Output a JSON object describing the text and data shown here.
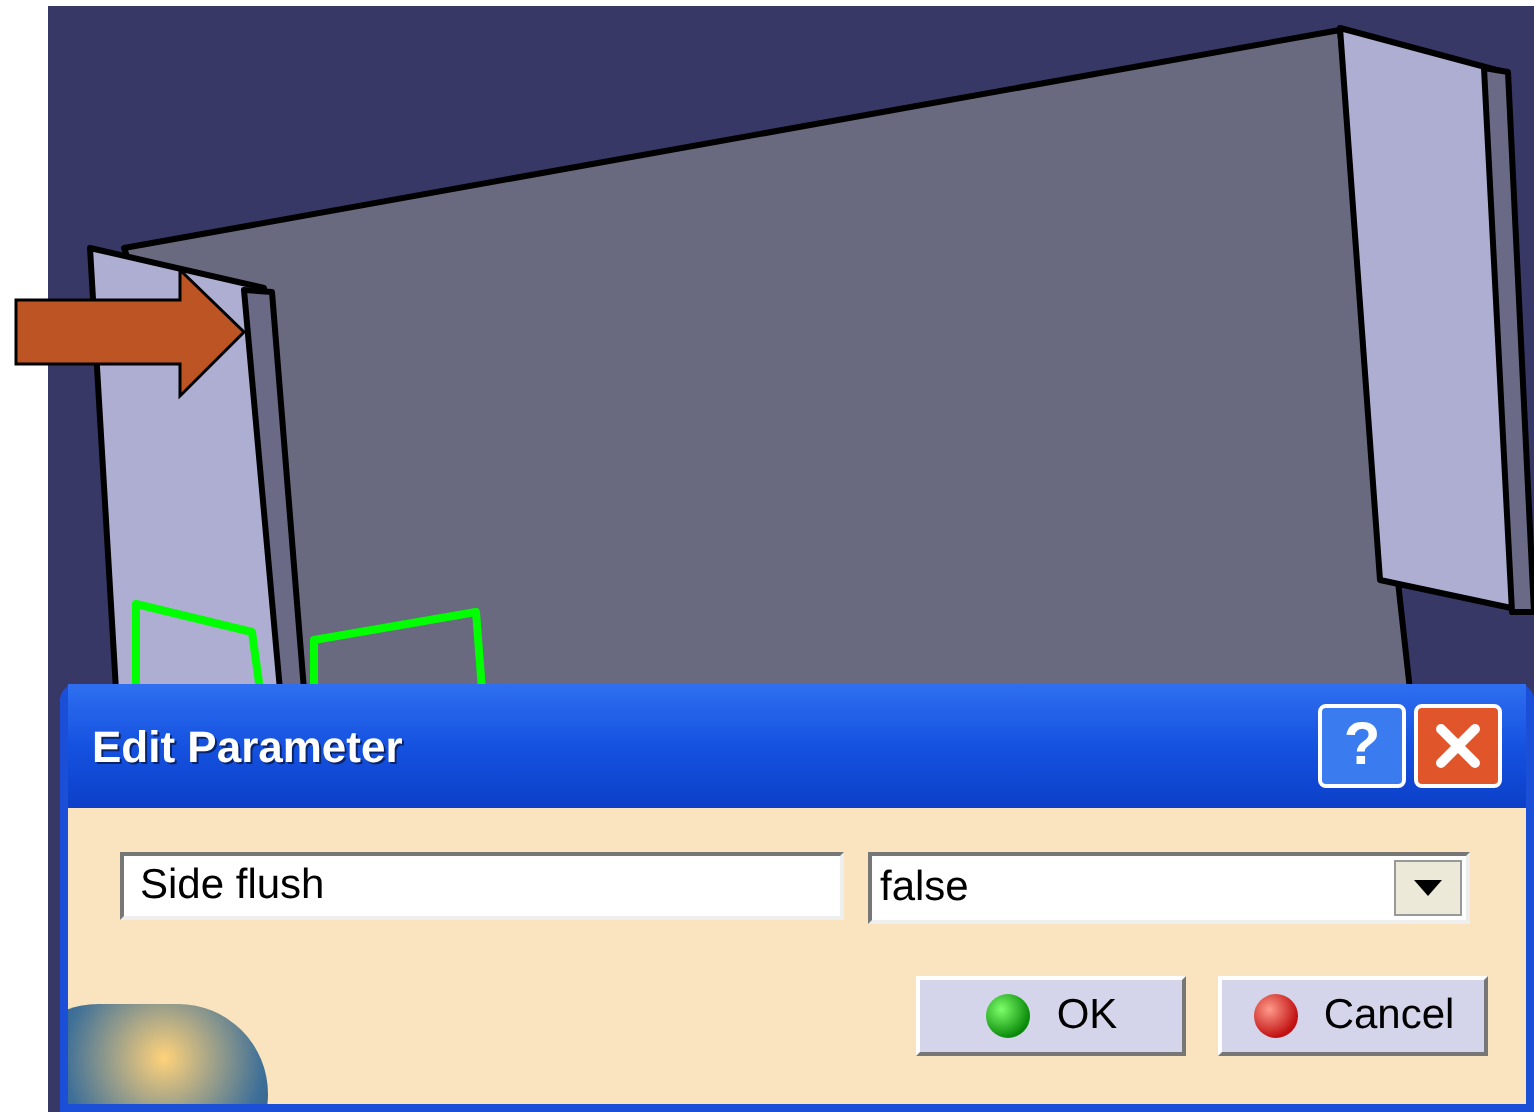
{
  "dialog": {
    "title": "Edit Parameter",
    "help_button": "?",
    "parameter_name": {
      "value": "Side flush"
    },
    "parameter_value": {
      "value": "false"
    },
    "buttons": [
      {
        "label": "OK",
        "kind": "ok"
      },
      {
        "label": "Cancel",
        "kind": "cancel"
      }
    ]
  }
}
